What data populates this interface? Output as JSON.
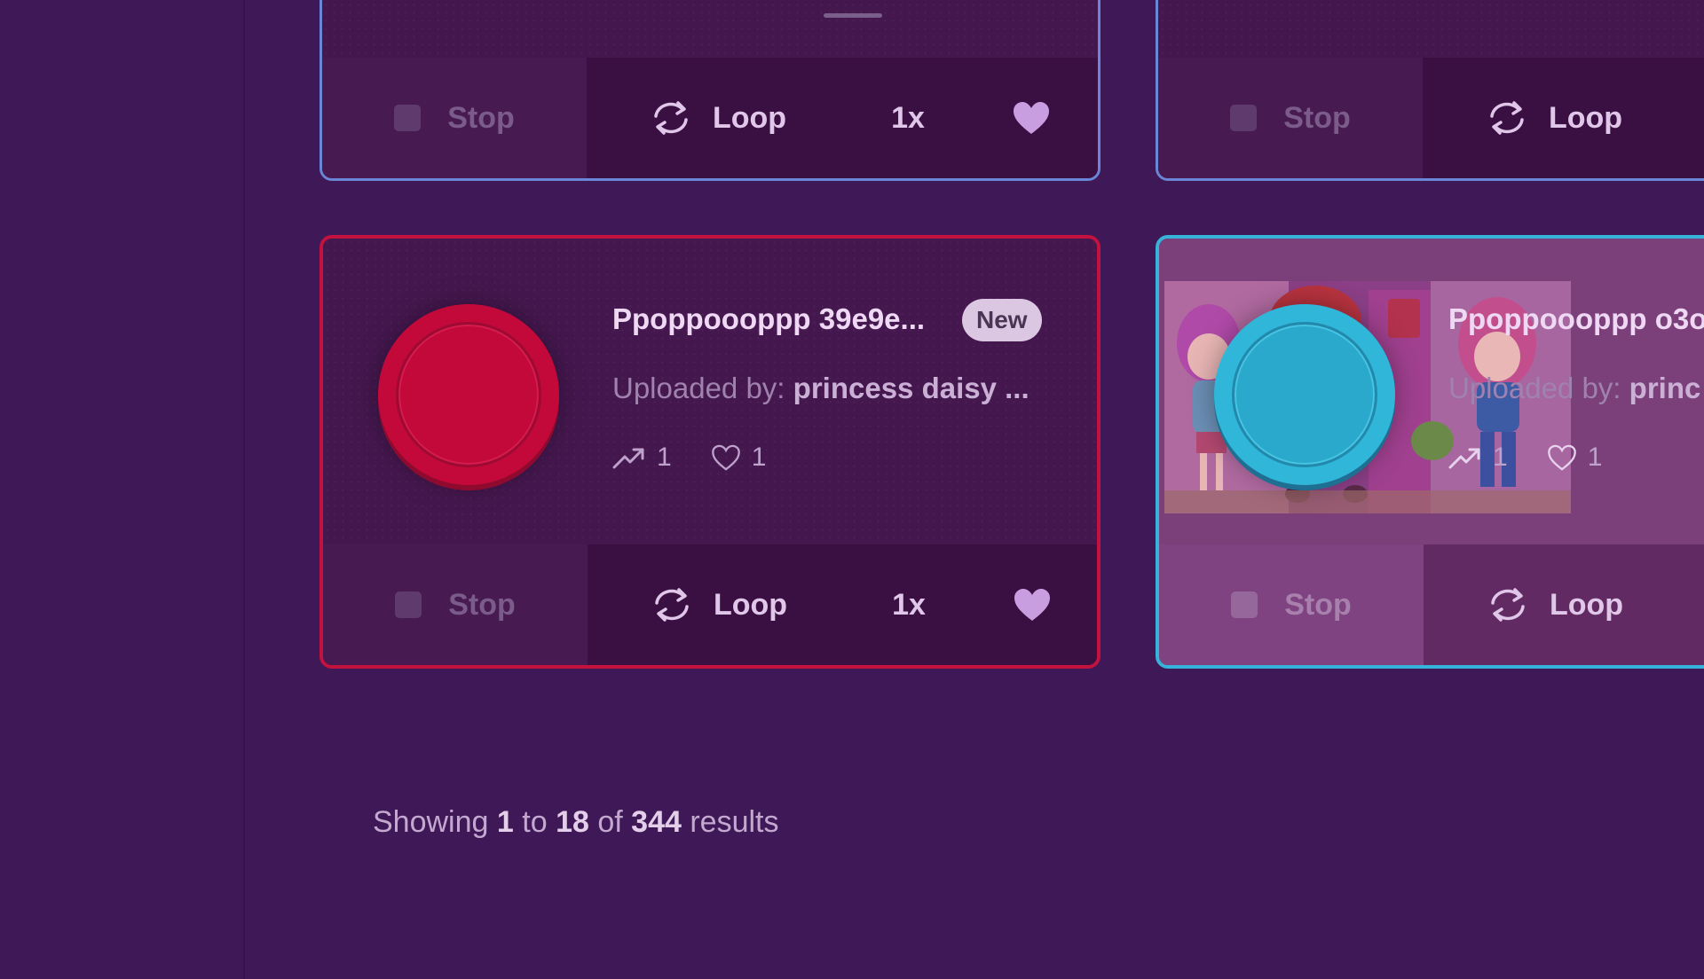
{
  "cards": [
    {
      "controls": {
        "stop_label": "Stop",
        "loop_label": "Loop",
        "speed_label": "1x"
      }
    },
    {
      "controls": {
        "stop_label": "Stop",
        "loop_label": "Loop"
      }
    },
    {
      "title": "Ppoppoooppp 39e9e...",
      "badge": "New",
      "uploader_prefix": "Uploaded by:",
      "uploader_name": "princess daisy ...",
      "trend_count": "1",
      "likes_count": "1",
      "button_color": "#c3093a",
      "controls": {
        "stop_label": "Stop",
        "loop_label": "Loop",
        "speed_label": "1x"
      }
    },
    {
      "title": "Ppoppoooppp o3o",
      "uploader_prefix": "Uploaded by:",
      "uploader_name": "princ",
      "trend_count": "1",
      "likes_count": "1",
      "button_color": "#2fb6d8",
      "controls": {
        "stop_label": "Stop",
        "loop_label": "Loop"
      }
    }
  ],
  "pagination": {
    "showing": "Showing",
    "from": "1",
    "to_word": "to",
    "to": "18",
    "of_word": "of",
    "total": "344",
    "results_word": "results"
  },
  "colors": {
    "card_border_blue": "#6a86d6",
    "card_border_red": "#c4123f",
    "card_border_cyan": "#36b3da",
    "background": "#3f1857"
  }
}
